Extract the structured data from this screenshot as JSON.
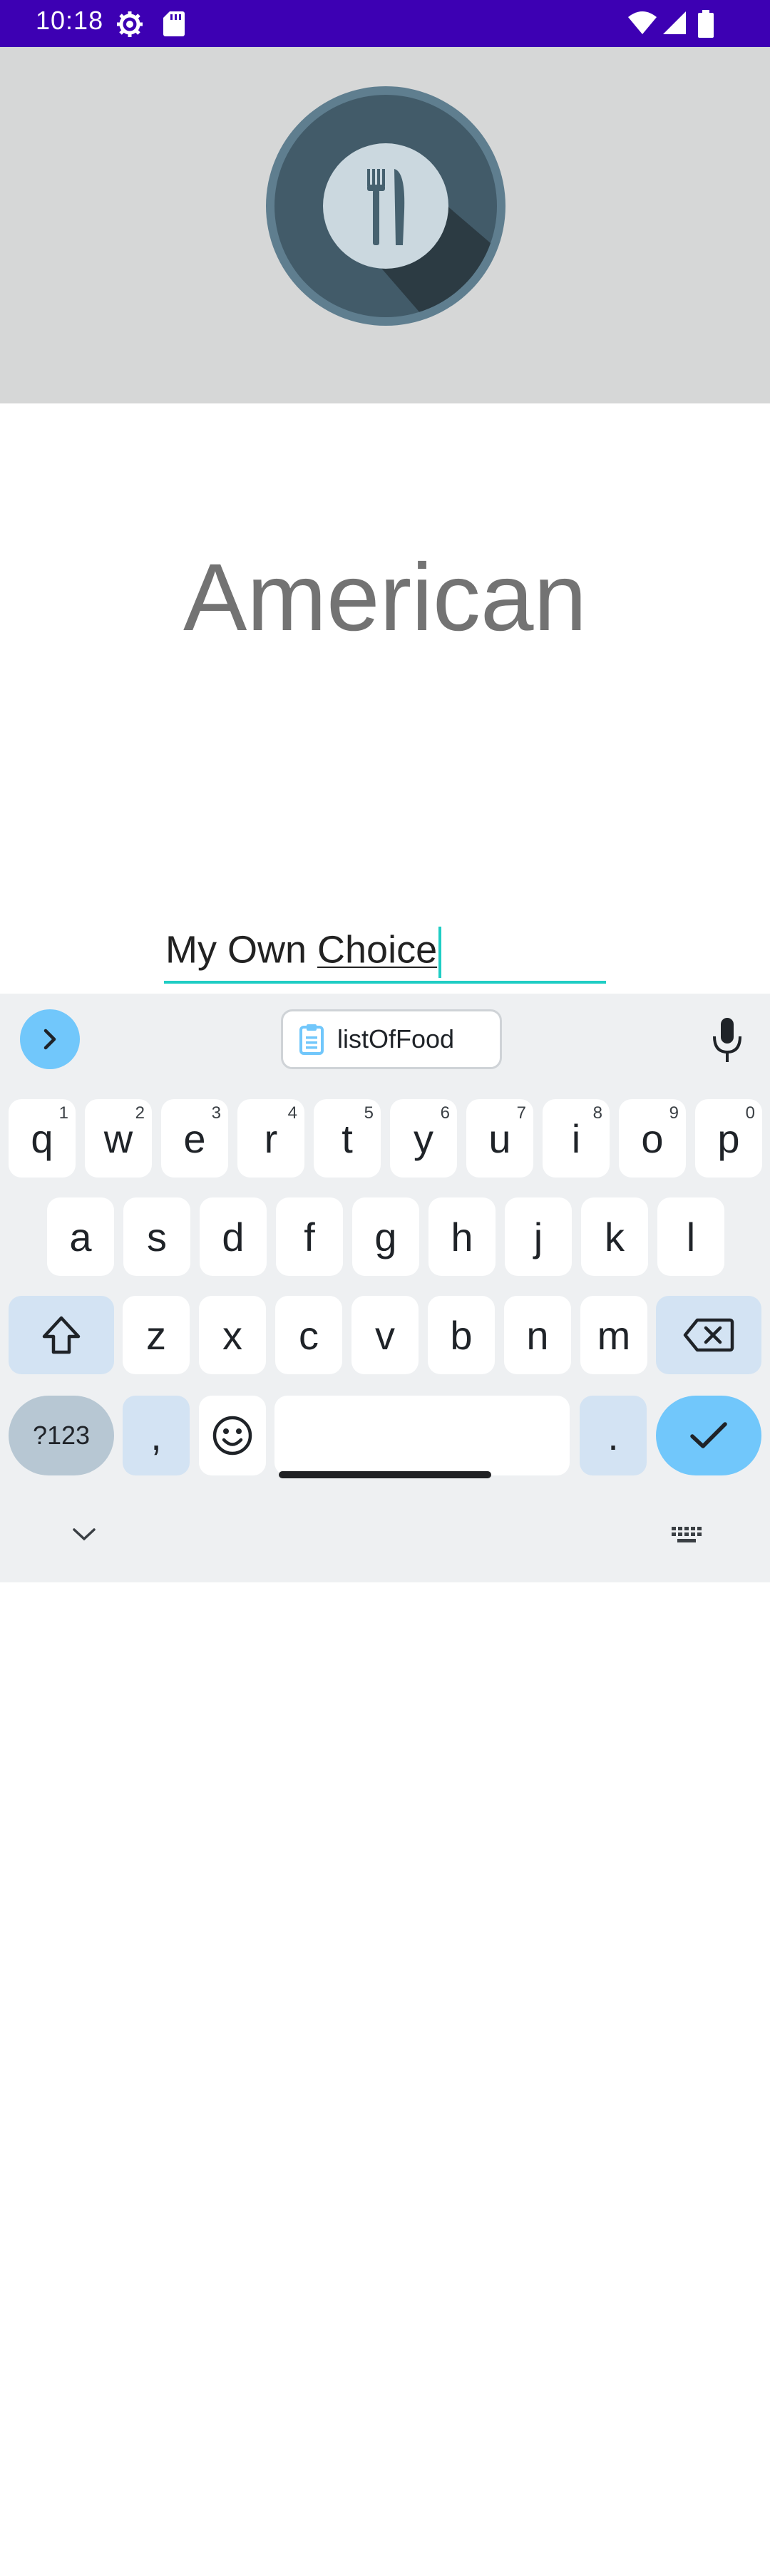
{
  "status_bar": {
    "time": "10:18",
    "icons": [
      "settings-icon",
      "sd-card-icon",
      "wifi-icon",
      "signal-icon",
      "battery-icon"
    ]
  },
  "header": {
    "logo_icon": "fork-knife-plate-icon",
    "background": "#d6d7d7"
  },
  "title": "American",
  "input": {
    "prefix": "My Own ",
    "composing": "Choice",
    "accent": "#1fcdc4"
  },
  "keyboard": {
    "clipboard_suggestion": "listOfFood",
    "row1": [
      {
        "k": "q",
        "h": "1"
      },
      {
        "k": "w",
        "h": "2"
      },
      {
        "k": "e",
        "h": "3"
      },
      {
        "k": "r",
        "h": "4"
      },
      {
        "k": "t",
        "h": "5"
      },
      {
        "k": "y",
        "h": "6"
      },
      {
        "k": "u",
        "h": "7"
      },
      {
        "k": "i",
        "h": "8"
      },
      {
        "k": "o",
        "h": "9"
      },
      {
        "k": "p",
        "h": "0"
      }
    ],
    "row2": [
      "a",
      "s",
      "d",
      "f",
      "g",
      "h",
      "j",
      "k",
      "l"
    ],
    "row3": [
      "z",
      "x",
      "c",
      "v",
      "b",
      "n",
      "m"
    ],
    "symbols_label": "?123",
    "comma_label": ",",
    "period_label": ".",
    "accent": "#71c7fb"
  }
}
